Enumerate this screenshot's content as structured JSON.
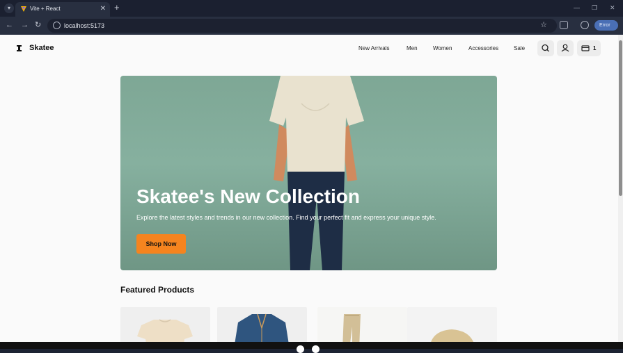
{
  "browser": {
    "tab_title": "Vite + React",
    "url": "localhost:5173",
    "profile_label": "Error"
  },
  "site": {
    "logo": "Skatee",
    "nav": [
      "New Arrivals",
      "Men",
      "Women",
      "Accessories",
      "Sale"
    ],
    "cart_count": "1"
  },
  "hero": {
    "title": "Skatee's New Collection",
    "subtitle": "Explore the latest styles and trends in our new collection. Find your perfect fit and express your unique style.",
    "cta": "Shop Now"
  },
  "featured": {
    "title": "Featured Products",
    "products": [
      {
        "item": "beige t-shirt"
      },
      {
        "item": "denim jacket"
      },
      {
        "item": "khaki pants"
      },
      {
        "item": "beige cap"
      }
    ]
  },
  "colors": {
    "accent": "#f5841f",
    "hero_bg": "#7ea795",
    "browser_chrome": "#1b2030"
  }
}
